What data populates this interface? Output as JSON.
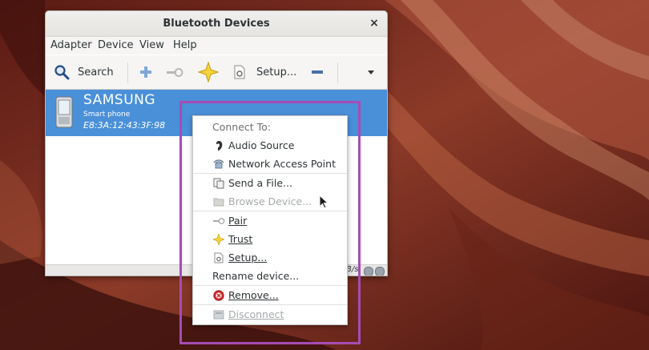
{
  "window": {
    "title": "Bluetooth Devices",
    "close_symbol": "×"
  },
  "menubar": [
    "Adapter",
    "Device",
    "View",
    "Help"
  ],
  "toolbar": {
    "search_label": "Search",
    "setup_label": "Setup...",
    "icons": [
      "search-icon",
      "add-icon",
      "key-icon",
      "star-icon",
      "setup-icon",
      "remove-icon",
      "dropdown-icon"
    ]
  },
  "device": {
    "name": "SAMSUNG",
    "type": "Smart phone",
    "address": "E8:3A:12:43:3F:98"
  },
  "statusbar": {
    "rate": "B/s"
  },
  "context_menu": {
    "header": "Connect To:",
    "audio_source": "Audio Source",
    "network_access_point": "Network Access Point",
    "send_file": "Send a File...",
    "browse_device": "Browse Device...",
    "pair": "Pair",
    "trust": "Trust",
    "setup": "Setup...",
    "rename": "Rename device...",
    "remove": "Remove...",
    "disconnect": "Disconnect"
  },
  "colors": {
    "selection": "#4a90d9",
    "highlight_box": "#a64cb5",
    "trust_star": "#f5d33a",
    "remove_red": "#d52a2a"
  }
}
